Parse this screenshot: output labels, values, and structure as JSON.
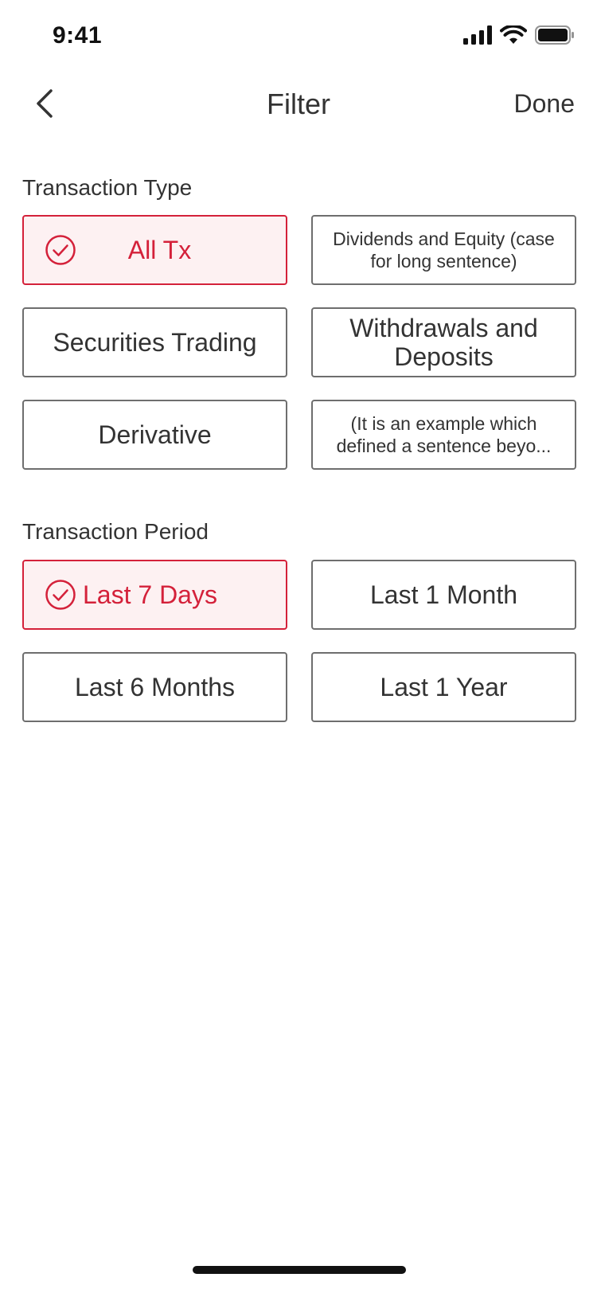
{
  "status_bar": {
    "time": "9:41",
    "icons": [
      "signal-icon",
      "wifi-icon",
      "battery-icon"
    ]
  },
  "nav": {
    "back_icon": "chevron-left-icon",
    "title": "Filter",
    "done_label": "Done"
  },
  "transaction_type": {
    "title": "Transaction Type",
    "options": [
      {
        "label": "All Tx",
        "selected": true
      },
      {
        "label": "Dividends and Equity (case for long sentence)",
        "selected": false
      },
      {
        "label": "Securities Trading",
        "selected": false
      },
      {
        "label": "Withdrawals and Deposits",
        "selected": false
      },
      {
        "label": "Derivative",
        "selected": false
      },
      {
        "label": "(It is an example which defined a sentence beyo...",
        "selected": false
      }
    ]
  },
  "transaction_period": {
    "title": "Transaction Period",
    "options": [
      {
        "label": "Last 7 Days",
        "selected": true
      },
      {
        "label": "Last 1 Month",
        "selected": false
      },
      {
        "label": "Last 6 Months",
        "selected": false
      },
      {
        "label": "Last 1 Year",
        "selected": false
      }
    ]
  },
  "colors": {
    "accent": "#d4213a",
    "accent_bg": "#fdf1f2",
    "border": "#6e6e6e",
    "text": "#333333"
  }
}
